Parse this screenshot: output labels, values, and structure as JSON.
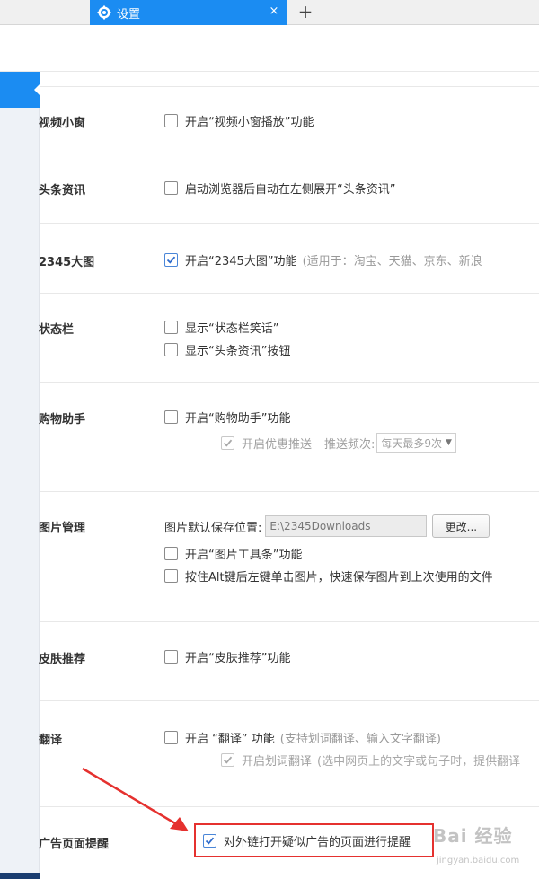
{
  "tab": {
    "title": "设置",
    "close": "×",
    "new_tab": "+"
  },
  "sections": {
    "video": {
      "title": "视频小窗",
      "opt1": "开启“视频小窗播放”功能"
    },
    "news": {
      "title": "头条资讯",
      "opt1": "启动浏览器后自动在左侧展开“头条资讯”"
    },
    "bigimage": {
      "title": "2345大图",
      "opt1": "开启“2345大图”功能",
      "opt1_note": "(适用于：淘宝、天猫、京东、新浪"
    },
    "statusbar": {
      "title": "状态栏",
      "opt1": "显示“状态栏笑话”",
      "opt2": "显示“头条资讯”按钮"
    },
    "shopping": {
      "title": "购物助手",
      "opt1": "开启“购物助手”功能",
      "opt2": "开启优惠推送",
      "freq_label": "推送频次:",
      "freq_value": "每天最多9次"
    },
    "image": {
      "title": "图片管理",
      "path_label": "图片默认保存位置:",
      "path_value": "E:\\2345Downloads",
      "change_button": "更改...",
      "opt1": "开启“图片工具条”功能",
      "opt2": "按住Alt键后左键单击图片，快速保存图片到上次使用的文件"
    },
    "skin": {
      "title": "皮肤推荐",
      "opt1": "开启“皮肤推荐”功能"
    },
    "translate": {
      "title": "翻译",
      "opt1": "开启 “翻译” 功能",
      "opt1_note": "(支持划词翻译、输入文字翻译)",
      "opt2": "开启划词翻译",
      "opt2_note": "(选中网页上的文字或句子时，提供翻译"
    },
    "ad": {
      "title": "广告页面提醒",
      "opt1": "对外链打开疑似广告的页面进行提醒"
    }
  },
  "watermark": {
    "logo": "Bai 经验",
    "url": "jingyan.baidu.com"
  },
  "colors": {
    "accent": "#1b8cf2",
    "highlight": "#e5312f"
  }
}
